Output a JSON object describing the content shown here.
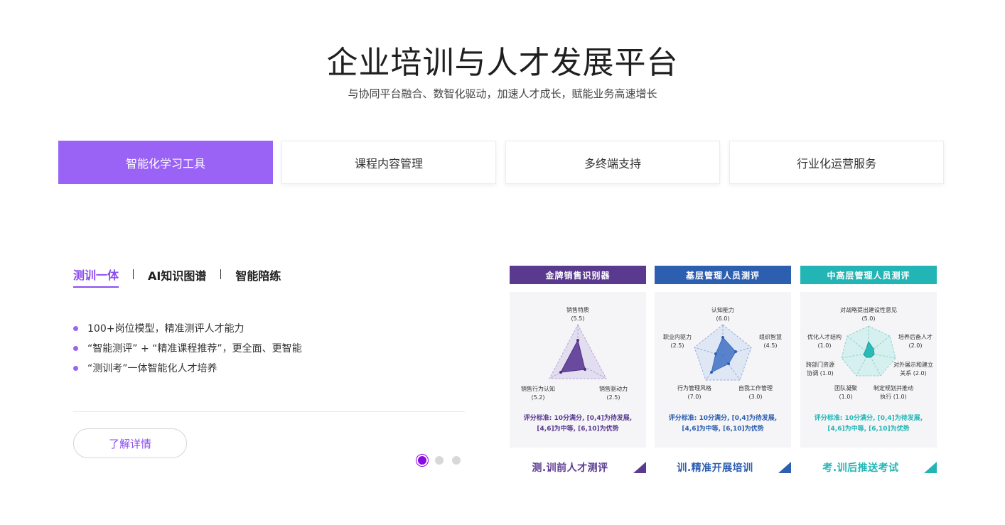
{
  "hero": {
    "title": "企业培训与人才发展平台",
    "subtitle": "与协同平台融合、数智化驱动，加速人才成长，赋能业务高速增长"
  },
  "tabs": [
    {
      "label": "智能化学习工具",
      "active": true
    },
    {
      "label": "课程内容管理",
      "active": false
    },
    {
      "label": "多终端支持",
      "active": false
    },
    {
      "label": "行业化运营服务",
      "active": false
    }
  ],
  "subtabs": [
    {
      "label": "测训一体",
      "active": true
    },
    {
      "label": "AI知识图谱",
      "active": false
    },
    {
      "label": "智能陪练",
      "active": false
    }
  ],
  "features": [
    "100+岗位模型，精准测评人才能力",
    "“智能测评” + “精准课程推荐”，更全面、更智能",
    "“测训考”一体智能化人才培养"
  ],
  "more_button": "了解详情",
  "pager": {
    "count": 3,
    "active": 0
  },
  "panels": [
    {
      "title": "金牌销售识别器",
      "color": "#5a3a8f",
      "labels": [
        "销售特质\n(5.5)",
        "销售驱动力\n(2.5)",
        "销售行为认知\n(5.2)"
      ],
      "standard": "评分标准: 10分满分, [0,4]为待发展,\n[4,6]为中等, [6,10]为优势",
      "footer": "测.训前人才测评"
    },
    {
      "title": "基层管理人员测评",
      "color": "#2d5fb0",
      "labels": [
        "认知能力\n(6.0)",
        "组织智慧\n(4.5)",
        "自我工作管理\n(3.0)",
        "行为管理风格\n(7.0)",
        "职业内驱力\n(2.5)"
      ],
      "standard": "评分标准: 10分满分, [0,4]为待发展,\n[4,6]为中等, [6,10]为优势",
      "footer": "训.精准开展培训"
    },
    {
      "title": "中高层管理人员测评",
      "color": "#23b5b5",
      "labels": [
        "对战略提出建设性意见\n(5.0)",
        "培养后备人才\n(2.0)",
        "对外展示和建立\n关系 (2.0)",
        "制定规划并推动\n执行 (1.0)",
        "团队凝聚\n(1.0)",
        "跨部门资源\n协调 (1.0)",
        "优化人才结构\n(1.0)"
      ],
      "standard": "评分标准: 10分满分, [0,4]为待发展,\n[4,6]为中等, [6,10]为优势",
      "footer": "考.训后推送考试"
    }
  ]
}
